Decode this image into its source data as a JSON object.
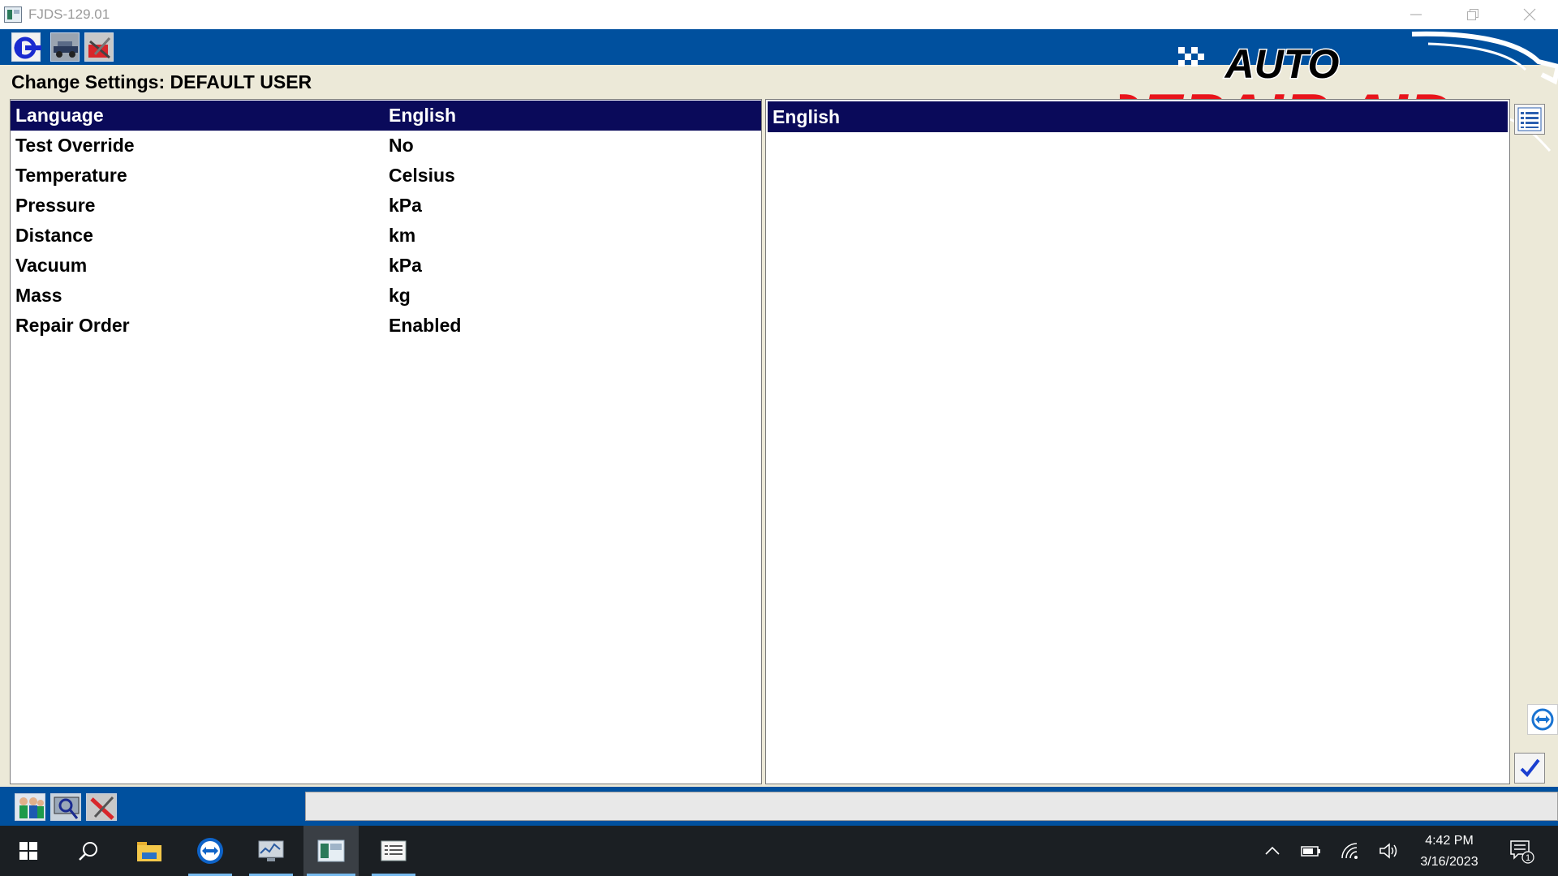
{
  "window": {
    "title": "FJDS-129.01",
    "controls": [
      "minimize-icon",
      "restore-icon",
      "close-icon"
    ]
  },
  "toolbar": {
    "icons": [
      "back-arrow-icon",
      "vehicle-tools-icon",
      "toolbox-icon"
    ]
  },
  "logo": {
    "line1": "AUTO",
    "line2": "REPAIR AID",
    "colors": {
      "line1": "#000000",
      "line2": "#e8141b"
    }
  },
  "page": {
    "title": "Change Settings: DEFAULT USER"
  },
  "settings": [
    {
      "key": "Language",
      "value": "English",
      "selected": true
    },
    {
      "key": "Test Override",
      "value": "No",
      "selected": false
    },
    {
      "key": "Temperature",
      "value": "Celsius",
      "selected": false
    },
    {
      "key": "Pressure",
      "value": "kPa",
      "selected": false
    },
    {
      "key": "Distance",
      "value": "km",
      "selected": false
    },
    {
      "key": "Vacuum",
      "value": "kPa",
      "selected": false
    },
    {
      "key": "Mass",
      "value": "kg",
      "selected": false
    },
    {
      "key": "Repair Order",
      "value": "Enabled",
      "selected": false
    }
  ],
  "options_panel": {
    "header": "English"
  },
  "side_buttons": [
    "list-icon",
    "teamviewer-icon",
    "checkmark-icon"
  ],
  "bottom_icons": [
    "people-icon",
    "inspect-icon",
    "tools-icon"
  ],
  "status": {
    "text": ""
  },
  "taskbar": {
    "apps": [
      "start-icon",
      "search-icon",
      "file-explorer-icon",
      "teamviewer-icon",
      "system-monitor-icon",
      "fjds-app-icon",
      "notepad-icon"
    ],
    "tray": [
      "chevron-up-icon",
      "battery-icon",
      "wifi-icon",
      "volume-icon"
    ],
    "time": "4:42 PM",
    "date": "3/16/2023",
    "notifications": "1"
  },
  "colors": {
    "brand_blue": "#00509e",
    "selection_navy": "#0a0a5a",
    "taskbar": "#1b1f23"
  }
}
